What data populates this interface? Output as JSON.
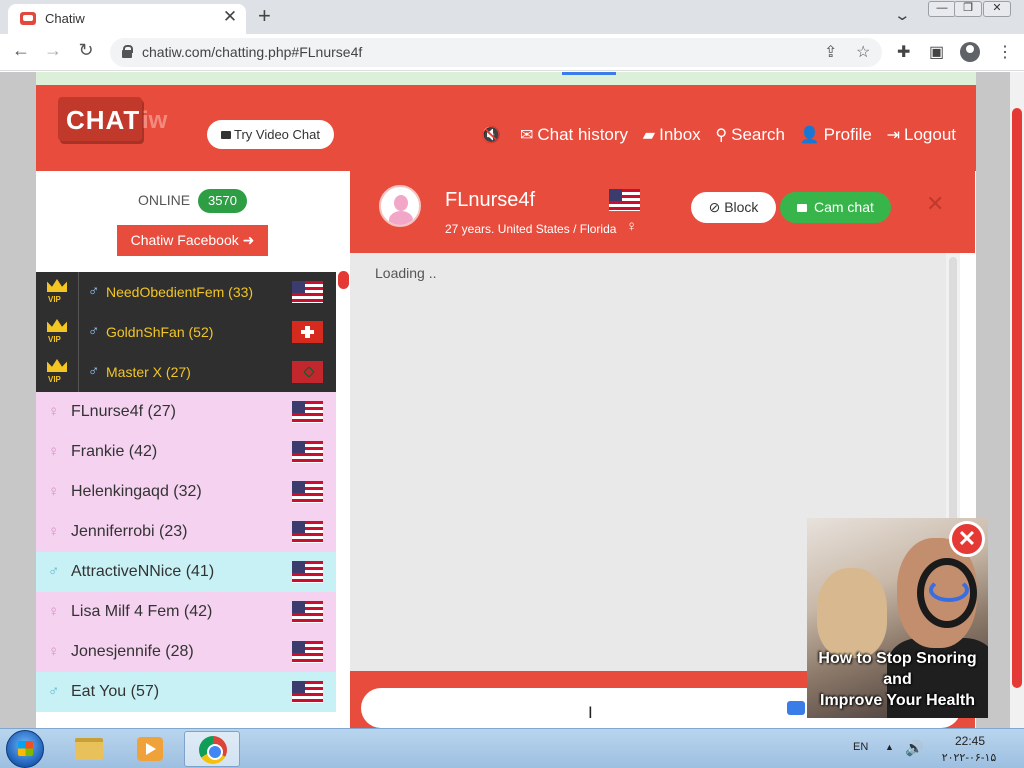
{
  "browser": {
    "tab_title": "Chatiw",
    "tab_close": "✕",
    "new_tab": "+",
    "url": "chatiw.com/chatting.php#FLnurse4f"
  },
  "header": {
    "logo_text": "CHAT",
    "logo_text_suffix": "iw",
    "try_video_label": "Try Video Chat",
    "nav": {
      "mute_icon": "🔇",
      "chat_history": "Chat history",
      "inbox": "Inbox",
      "search": "Search",
      "profile": "Profile",
      "logout": "Logout"
    }
  },
  "sidebar": {
    "online_label": "ONLINE",
    "online_count": "3570",
    "facebook_button": "Chatiw Facebook",
    "vip_label": "VIP",
    "users": [
      {
        "name": "NeedObedientFem (33)",
        "type": "vip",
        "gender": "male",
        "flag": "us"
      },
      {
        "name": "GoldnShFan (52)",
        "type": "vip",
        "gender": "male",
        "flag": "ch"
      },
      {
        "name": "Master X (27)",
        "type": "vip",
        "gender": "male",
        "flag": "ma"
      },
      {
        "name": "FLnurse4f (27)",
        "type": "female",
        "gender": "female",
        "flag": "us"
      },
      {
        "name": "Frankie (42)",
        "type": "female",
        "gender": "female",
        "flag": "us"
      },
      {
        "name": "Helenkingaqd (32)",
        "type": "female",
        "gender": "female",
        "flag": "us"
      },
      {
        "name": "Jenniferrobi (23)",
        "type": "female",
        "gender": "female",
        "flag": "us"
      },
      {
        "name": "AttractiveNNice (41)",
        "type": "male",
        "gender": "male",
        "flag": "us"
      },
      {
        "name": "Lisa Milf 4 Fem (42)",
        "type": "female",
        "gender": "female",
        "flag": "us"
      },
      {
        "name": "Jonesjennife (28)",
        "type": "female",
        "gender": "female",
        "flag": "us"
      },
      {
        "name": "Eat You (57)",
        "type": "male",
        "gender": "male",
        "flag": "us"
      }
    ]
  },
  "chat": {
    "name": "FLnurse4f",
    "info": "27 years. United States / Florida",
    "block_label": "Block",
    "cam_chat_label": "Cam chat",
    "close_symbol": "✕",
    "loading_text": "Loading ..",
    "message_value": ""
  },
  "ad": {
    "caption_line1": "How to Stop Snoring",
    "caption_line2": "and",
    "caption_line3": "Improve Your Health",
    "close_symbol": "✕"
  },
  "taskbar": {
    "language": "EN",
    "time": "22:45",
    "date": "۲۰۲۲-۰۶-۱۵"
  },
  "colors": {
    "brand_red": "#e84c3d",
    "vip_gold": "#f3c623",
    "female_row": "#f4d2f0",
    "male_row": "#c8f1f6",
    "online_green": "#2e9e44",
    "cam_green": "#38b54a"
  }
}
